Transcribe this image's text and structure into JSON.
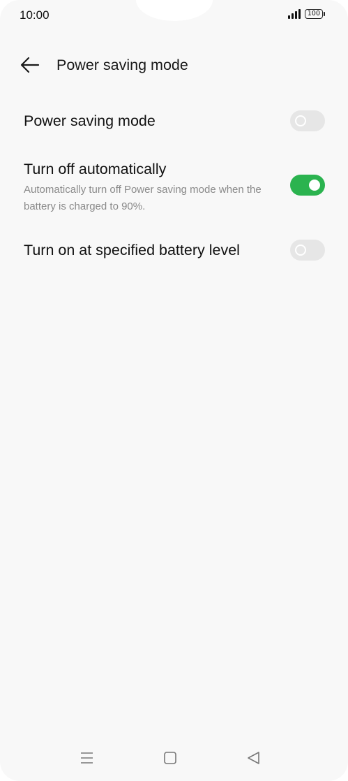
{
  "status_bar": {
    "time": "10:00",
    "battery_level": "100",
    "signal_icon": "signal-bars-icon",
    "battery_icon": "battery-icon"
  },
  "header": {
    "back_icon": "arrow-left-icon",
    "title": "Power saving mode"
  },
  "settings": [
    {
      "title": "Power saving mode",
      "description": "",
      "enabled": false
    },
    {
      "title": "Turn off automatically",
      "description": "Automatically turn off Power saving mode when the battery is charged to 90%.",
      "enabled": true
    },
    {
      "title": "Turn on at specified battery level",
      "description": "",
      "enabled": false
    }
  ],
  "nav_bar": {
    "menu_icon": "menu-icon",
    "home_icon": "home-square-icon",
    "back_icon": "back-triangle-icon"
  },
  "colors": {
    "background": "#f8f8f8",
    "toggle_on": "#2bb34f",
    "toggle_off": "#e6e6e6",
    "secondary_text": "#8a8a8a"
  }
}
